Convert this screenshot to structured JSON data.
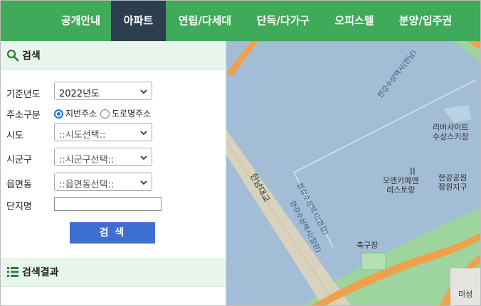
{
  "nav": {
    "items": [
      {
        "label": "공개안내"
      },
      {
        "label": "아파트",
        "active": true
      },
      {
        "label": "연립/다세대"
      },
      {
        "label": "단독/다가구"
      },
      {
        "label": "오피스텔"
      },
      {
        "label": "분양/입주권"
      }
    ]
  },
  "search_panel": {
    "title": "검색",
    "year": {
      "label": "기준년도",
      "value": "2022년도"
    },
    "address_type": {
      "label": "주소구분",
      "options": [
        {
          "label": "지번주소",
          "checked": true
        },
        {
          "label": "도로명주소",
          "checked": false
        }
      ]
    },
    "sido": {
      "label": "시도",
      "value": "::시도선택::"
    },
    "sigungu": {
      "label": "시군구",
      "value": "::시군구선택::"
    },
    "eupmyeondong": {
      "label": "읍면동",
      "value": "::읍면동선택::"
    },
    "complex_name": {
      "label": "단지명",
      "value": ""
    },
    "search_button": "검 색"
  },
  "results_panel": {
    "title": "검색결과"
  },
  "map": {
    "labels": {
      "bridge": "한남대교",
      "river_topright": "한강수상택시(한남)",
      "river_mid1": "한강수상택시(한강)",
      "river_mid2": "한강수상택시(잠원)",
      "riverside_station": "리버사이트\n수상스키장",
      "cafe": "오엔카페앤\n레스토랑",
      "park": "한강공원\n잠원지구",
      "soccer": "축구장",
      "bottom_right": "미성"
    }
  },
  "colors": {
    "nav_bg": "#3faa59",
    "nav_active": "#2c3e50",
    "panel_bg": "#e8f5ec",
    "button_bg": "#3d6fd1",
    "water": "#a3bdd6",
    "park": "#9ed49e",
    "road": "#f0a04b"
  }
}
